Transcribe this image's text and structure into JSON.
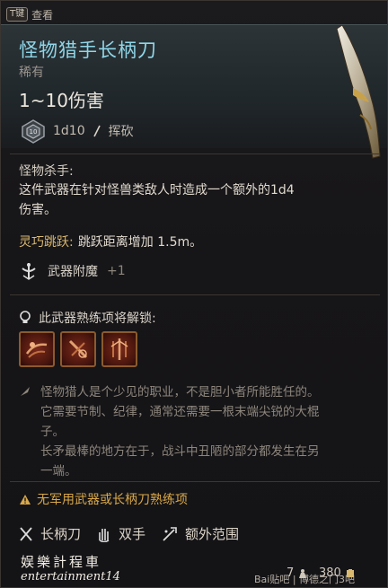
{
  "topbar": {
    "key": "T键",
    "label": "查看"
  },
  "item": {
    "name": "怪物猎手长柄刀",
    "rarity": "稀有",
    "damage": "1~10伤害",
    "dice": "1d10",
    "damage_type": "挥砍"
  },
  "passive1": {
    "name": "怪物杀手:",
    "desc_line1": "这件武器在针对怪兽类敌人时造成一个额外的1d4",
    "desc_line2": "伤害。"
  },
  "passive2": {
    "name": "灵巧跳跃:",
    "desc": "跳跃距离增加 1.5m。"
  },
  "enchant": {
    "label": "武器附魔",
    "value": "+1"
  },
  "proficiency": {
    "label": "此武器熟练项将解锁:"
  },
  "lore": {
    "line1": "怪物猎人是个少见的职业，不是胆小者所能胜任的。",
    "line2": "它需要节制、纪律，通常还需要一根末端尖锐的大棍",
    "line3": "子。",
    "line4": "长矛最棒的地方在于，战斗中丑陋的部分都发生在另",
    "line5": "一端。"
  },
  "warning": "无军用武器或长柄刀熟练项",
  "tags": [
    {
      "icon": "polearm-icon",
      "label": "长柄刀"
    },
    {
      "icon": "two-handed-icon",
      "label": "双手"
    },
    {
      "icon": "reach-icon",
      "label": "额外范围"
    }
  ],
  "footer": {
    "watermark_cn": "娱樂計程車",
    "watermark_en": "entertainment14",
    "baidu": "Bai贴吧 | 博德之门3吧",
    "weight": "7",
    "price": "380"
  },
  "colors": {
    "title": "#8fd6e8",
    "warning": "#d9a84a",
    "action_border": "#8c5a2e"
  }
}
